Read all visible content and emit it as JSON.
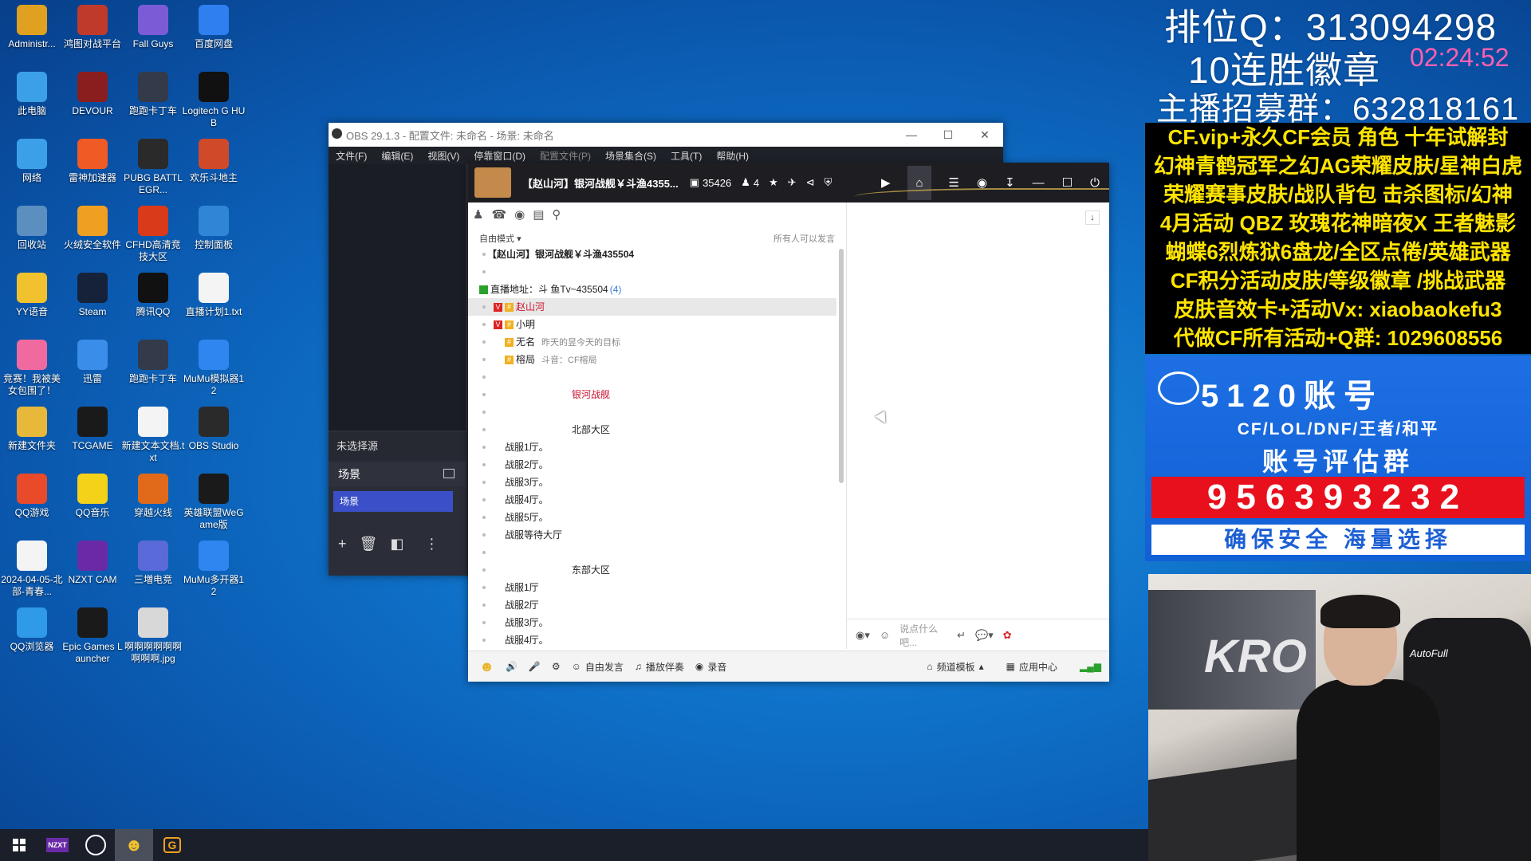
{
  "desktop": {
    "icons": [
      {
        "label": "Administr...",
        "icon": "user-folder-icon",
        "color": "#e0a020"
      },
      {
        "label": "鸿图对战平台",
        "icon": "game-platform-icon",
        "color": "#c03a2b"
      },
      {
        "label": "Fall Guys",
        "icon": "fall-guys-icon",
        "color": "#7b5cd6"
      },
      {
        "label": "百度网盘",
        "icon": "baidu-netdisk-icon",
        "color": "#2f7ff0"
      },
      {
        "label": "此电脑",
        "icon": "computer-icon",
        "color": "#3ba0e8"
      },
      {
        "label": "DEVOUR",
        "icon": "devour-icon",
        "color": "#8a1d1d"
      },
      {
        "label": "跑跑卡丁车",
        "icon": "kart-icon",
        "color": "#333a4a"
      },
      {
        "label": "Logitech G HUB",
        "icon": "logitech-icon",
        "color": "#111111"
      },
      {
        "label": "网络",
        "icon": "network-icon",
        "color": "#3ba0e8"
      },
      {
        "label": "雷神加速器",
        "icon": "accelerator-icon",
        "color": "#f05a24"
      },
      {
        "label": "PUBG BATTLEGR...",
        "icon": "pubg-icon",
        "color": "#2a2a2a"
      },
      {
        "label": "欢乐斗地主",
        "icon": "poker-game-icon",
        "color": "#d04a2a"
      },
      {
        "label": "回收站",
        "icon": "recycle-bin-icon",
        "color": "#5b8fbf"
      },
      {
        "label": "火绒安全软件",
        "icon": "huorong-icon",
        "color": "#f0a020"
      },
      {
        "label": "CFHD高清竞技大区",
        "icon": "cfhd-icon",
        "color": "#d83a1a"
      },
      {
        "label": "控制面板",
        "icon": "control-panel-icon",
        "color": "#2f86d6"
      },
      {
        "label": "YY语音",
        "icon": "yy-icon",
        "color": "#f2c12e"
      },
      {
        "label": "Steam",
        "icon": "steam-icon",
        "color": "#16223a"
      },
      {
        "label": "腾讯QQ",
        "icon": "qq-icon",
        "color": "#111111"
      },
      {
        "label": "直播计划1.txt",
        "icon": "text-file-icon",
        "color": "#f4f4f4"
      },
      {
        "label": "竞赛！我被美女包围了！",
        "icon": "heart-game-icon",
        "color": "#f06aa0"
      },
      {
        "label": "迅雷",
        "icon": "xunlei-icon",
        "color": "#3a8de8"
      },
      {
        "label": "跑跑卡丁车",
        "icon": "kart-icon",
        "color": "#333a4a"
      },
      {
        "label": "MuMu模拟器12",
        "icon": "mumu-icon",
        "color": "#2f86f0"
      },
      {
        "label": "新建文件夹",
        "icon": "folder-icon",
        "color": "#e8b83a"
      },
      {
        "label": "TCGAME",
        "icon": "tcgame-icon",
        "color": "#1a1a1a"
      },
      {
        "label": "新建文本文档.txt",
        "icon": "text-file-icon",
        "color": "#f4f4f4"
      },
      {
        "label": "OBS Studio",
        "icon": "obs-icon",
        "color": "#2a2a2a"
      },
      {
        "label": "QQ游戏",
        "icon": "qq-game-icon",
        "color": "#e84a2a"
      },
      {
        "label": "QQ音乐",
        "icon": "qq-music-icon",
        "color": "#f4d21a"
      },
      {
        "label": "穿越火线",
        "icon": "crossfire-icon",
        "color": "#e06a1a"
      },
      {
        "label": "英雄联盟WeGame版",
        "icon": "lol-icon",
        "color": "#1a1a1a"
      },
      {
        "label": "2024-04-05-北部-青春...",
        "icon": "file-icon",
        "color": "#f4f4f4"
      },
      {
        "label": "NZXT CAM",
        "icon": "nzxt-icon",
        "color": "#6a2aa8"
      },
      {
        "label": "三増电竞",
        "icon": "esports-icon",
        "color": "#5a6ad8"
      },
      {
        "label": "MuMu多开器12",
        "icon": "mumu-multi-icon",
        "color": "#2f86f0"
      },
      {
        "label": "QQ浏览器",
        "icon": "qq-browser-icon",
        "color": "#2f9ae8"
      },
      {
        "label": "Epic Games Launcher",
        "icon": "epic-icon",
        "color": "#1a1a1a"
      },
      {
        "label": "啊啊啊啊啊啊啊啊啊.jpg",
        "icon": "image-file-icon",
        "color": "#d8d8d8"
      }
    ]
  },
  "obs": {
    "title": "OBS 29.1.3 - 配置文件: 未命名 - 场景: 未命名",
    "menu": [
      "文件(F)",
      "编辑(E)",
      "视图(V)",
      "停靠窗口(D)",
      "配置文件(P)",
      "场景集合(S)",
      "工具(T)",
      "帮助(H)"
    ],
    "no_source": "未选择源",
    "scenes_header": "场景",
    "scene_item": "场景"
  },
  "yy": {
    "channel_title": "【赵山河】银河战舰￥斗渔4355...",
    "channel_id": "35426",
    "online": "4",
    "mode": "自由模式",
    "speak_setting": "所有人可以发言",
    "tree": [
      {
        "text": "【赵山河】银河战舰￥斗渔435504",
        "indent": 24,
        "bold": true,
        "lock": true
      },
      {
        "text": "",
        "indent": 24
      },
      {
        "text": "直播地址：斗 鱼Tv~435504",
        "suffix": "(4)",
        "indent": 14,
        "live": true
      },
      {
        "text": "赵山河",
        "indent": 32,
        "sel": true,
        "red": true,
        "badges": [
          "V",
          "#"
        ]
      },
      {
        "text": "小明",
        "indent": 32,
        "badges": [
          "V",
          "#"
        ]
      },
      {
        "text": "无名",
        "indent": 46,
        "note": "昨天的昱今天的目标",
        "badges": [
          "#"
        ]
      },
      {
        "text": "榕局",
        "indent": 46,
        "note": "斗音：CF榕局",
        "badges": [
          "#"
        ]
      },
      {
        "text": "",
        "indent": 24
      },
      {
        "text": "银河战舰",
        "indent": 130,
        "red": true,
        "lock": true
      },
      {
        "text": "",
        "indent": 24
      },
      {
        "text": "北部大区",
        "indent": 130,
        "lock": true
      },
      {
        "text": "战服1厅。",
        "indent": 46
      },
      {
        "text": "战服2厅。",
        "indent": 46
      },
      {
        "text": "战服3厅。",
        "indent": 46
      },
      {
        "text": "战服4厅。",
        "indent": 46
      },
      {
        "text": "战服5厅。",
        "indent": 46
      },
      {
        "text": "战服等待大厅",
        "indent": 46
      },
      {
        "text": "",
        "indent": 24
      },
      {
        "text": "东部大区",
        "indent": 130,
        "lock": true
      },
      {
        "text": "战服1厅",
        "indent": 46
      },
      {
        "text": "战服2厅",
        "indent": 46
      },
      {
        "text": "战服3厅。",
        "indent": 46
      },
      {
        "text": "战服4厅。",
        "indent": 46
      }
    ],
    "input_placeholder": "说点什么吧...",
    "bottom": {
      "free_speak": "自由发言",
      "accompany": "播放伴奏",
      "record": "录音",
      "template": "频道模板",
      "app_center": "应用中心"
    }
  },
  "overlay": {
    "rank_q": "排位Q：313094298",
    "badge": "10连胜徽章",
    "clock": "02:24:52",
    "recruit": "主播招募群：632818161",
    "promo_lines": [
      "CF.vip+永久CF会员 角色 十年试解封",
      "幻神青鹤冠军之幻AG荣耀皮肤/星神白虎",
      "荣耀赛事皮肤/战队背包 击杀图标/幻神",
      "4月活动 QBZ 玫瑰花神暗夜X 王者魅影",
      "蝴蝶6烈炼狱6盘龙/全区点倦/英雄武器",
      "CF积分活动皮肤/等级徽章 /挑战武器",
      "皮肤音效卡+活动Vx: xiaobaokefu3",
      "代做CF所有活动+Q群: 1029608556"
    ],
    "ad": {
      "title": "5120账号",
      "games": "CF/LOL/DNF/王者/和平",
      "group": "账号评估群",
      "number": "956393232",
      "slogan": "确保安全 海量选择"
    },
    "camera": {
      "banner_text": "KRO",
      "chair_brand": "AutoFull"
    }
  }
}
